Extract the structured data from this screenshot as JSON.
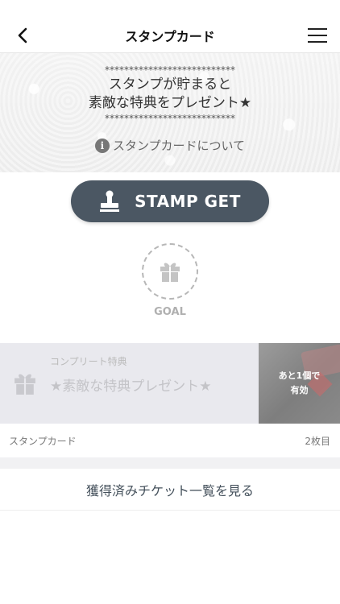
{
  "header": {
    "title": "スタンプカード",
    "back_icon": "chevron-left-icon",
    "menu_icon": "hamburger-menu-icon"
  },
  "hero": {
    "stars_top": "***************************",
    "message_line1": "スタンプが貯まると",
    "message_line2": "素敵な特典をプレゼント★",
    "stars_bottom": "***************************",
    "about_label": "スタンプカードについて",
    "about_icon": "info-icon"
  },
  "stamp_button": {
    "label": "STAMP GET",
    "icon": "stamp-icon",
    "color": "#4b5763"
  },
  "goal": {
    "label": "GOAL",
    "icon": "gift-icon"
  },
  "complete_reward": {
    "sub_label": "コンプリート特典",
    "title": "★素敵な特典プレゼント★",
    "status_line1": "あと1個で",
    "status_line2": "有効",
    "icon": "gift-icon"
  },
  "card_meta": {
    "card_name": "スタンプカード",
    "card_count": "2枚目"
  },
  "ticket_link": {
    "label": "獲得済みチケット一覧を見る"
  }
}
